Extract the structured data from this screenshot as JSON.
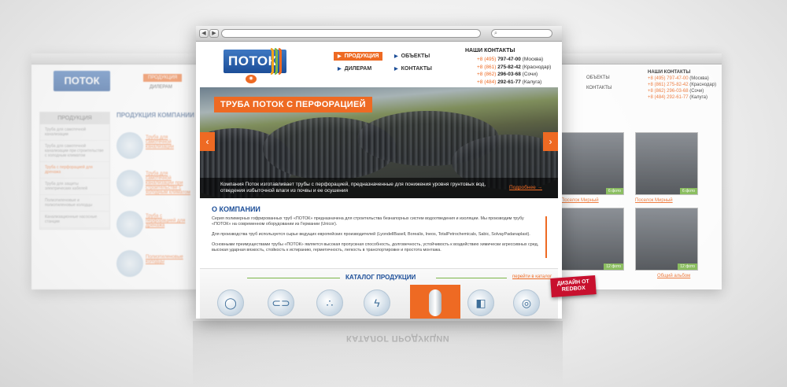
{
  "left_window": {
    "logo": "ПОТОК",
    "menu": [
      "ПРОДУКЦИЯ",
      "ДИЛЕРАМ"
    ],
    "sidebar_title": "ПРОДУКЦИЯ",
    "sidebar_items": [
      "Труба для самотечной канализации",
      "Труба для самотечной канализации при строительстве с холодным климатом",
      "Труба с перфорацией для дренажа",
      "Труба для защиты электрических кабелей",
      "Полиэтиленовые и полиэтиленовые колодцы",
      "Канализационные насосные станции"
    ],
    "heading": "ПРОДУКЦИЯ КОМПАНИИ ПОТОК",
    "products": [
      "Труба для самотечной канализации",
      "Труба для самотечной канализации при строительстве с холодным климатом",
      "Труба с перфорацией для дренажа",
      "Полиэтиленовые колодцы"
    ]
  },
  "right_window": {
    "menu": [
      "ОБЪЕКТЫ",
      "КОНТАКТЫ"
    ],
    "contacts_title": "НАШИ КОНТАКТЫ",
    "contacts": [
      {
        "phone": "+8 (495) 797-47-00",
        "city": "(Москва)"
      },
      {
        "phone": "+8 (861) 275-82-42",
        "city": "(Краснодар)"
      },
      {
        "phone": "+8 (862) 296-03-68",
        "city": "(Сочи)"
      },
      {
        "phone": "+8 (484) 292-61-77",
        "city": "(Калуга)"
      }
    ],
    "cards": [
      {
        "link": "Поселок Мирный",
        "tag": "6 фото"
      },
      {
        "link": "Поселок Мирный",
        "tag": "6 фото"
      },
      {
        "link": "",
        "tag": "12 фото"
      },
      {
        "link": "Общий альбом",
        "tag": "12 фото"
      }
    ]
  },
  "browser": {
    "nav_back": "◀",
    "nav_forward": "▶",
    "search_icon": "magnifier-icon"
  },
  "header": {
    "logo": "ПОТОК",
    "menu": {
      "products": "ПРОДУКЦИЯ",
      "objects": "ОБЪЕКТЫ",
      "dealers": "ДИЛЕРАМ",
      "contacts": "КОНТАКТЫ"
    },
    "contacts_title": "НАШИ КОНТАКТЫ",
    "contacts": [
      {
        "code": "+8 (495)",
        "number": "797-47-00",
        "city": "(Москва)"
      },
      {
        "code": "+8 (861)",
        "number": "275-82-42",
        "city": "(Краснодар)"
      },
      {
        "code": "+8 (862)",
        "number": "296-03-68",
        "city": "(Сочи)"
      },
      {
        "code": "+8 (484)",
        "number": "292-61-77",
        "city": "(Калуга)"
      }
    ]
  },
  "slider": {
    "title": "ТРУБА ПОТОК С ПЕРФОРАЦИЕЙ",
    "prev": "‹",
    "next": "›",
    "caption": "Компания Поток изготавливает трубы с перфорацией, предназначенные для понижения уровня грунтовых вод, отведения избыточной влаги из почвы и ее осушения",
    "more": "Подробнее →"
  },
  "about": {
    "title": "О КОМПАНИИ",
    "p1": "Серия полимерных гофрированных труб «ПОТОК» предназначена для строительства безнапорных систем водоотведения и изоляции. Мы производим трубу «ПОТОК» на современном оборудовании из Германии (Unicor).",
    "p2": "Для производства труб используется сырье ведущих европейских производителей (LyondellBasell, Borealis, Ineos, TotalPetrochemicals, Sabic, SolvayPadanaplast).",
    "p3": "Основными преимуществами трубы «ПОТОК» является высокая пропускная способность, долговечность, устойчивость к воздействию химически агрессивных сред, высокая ударная вязкость, стойкость к истиранию, герметичность, легкость в транспортировке и простота монтажа."
  },
  "catalog": {
    "title": "КАТАЛОГ ПРОДУКЦИИ",
    "link": "перейти в каталог",
    "icons": [
      "pipe-icon",
      "pipe-coupling-icon",
      "pipe-drops-icon",
      "cable-pipe-icon",
      "well-icon",
      "pump-station-icon",
      "tank-icon"
    ],
    "glyphs": [
      "◯",
      "⊂⊃",
      "∴",
      "ϟ",
      "▮",
      "◧",
      "◎"
    ]
  },
  "badge": {
    "line1": "ДИЗАЙН ОТ",
    "line2": "REDBOX"
  },
  "reflection": "КАТАЛОГ ПРОДУКЦИИ",
  "colors": {
    "accent": "#ee6a23",
    "brand": "#1c4e98",
    "green": "#7ab648",
    "badge": "#c8102e"
  }
}
